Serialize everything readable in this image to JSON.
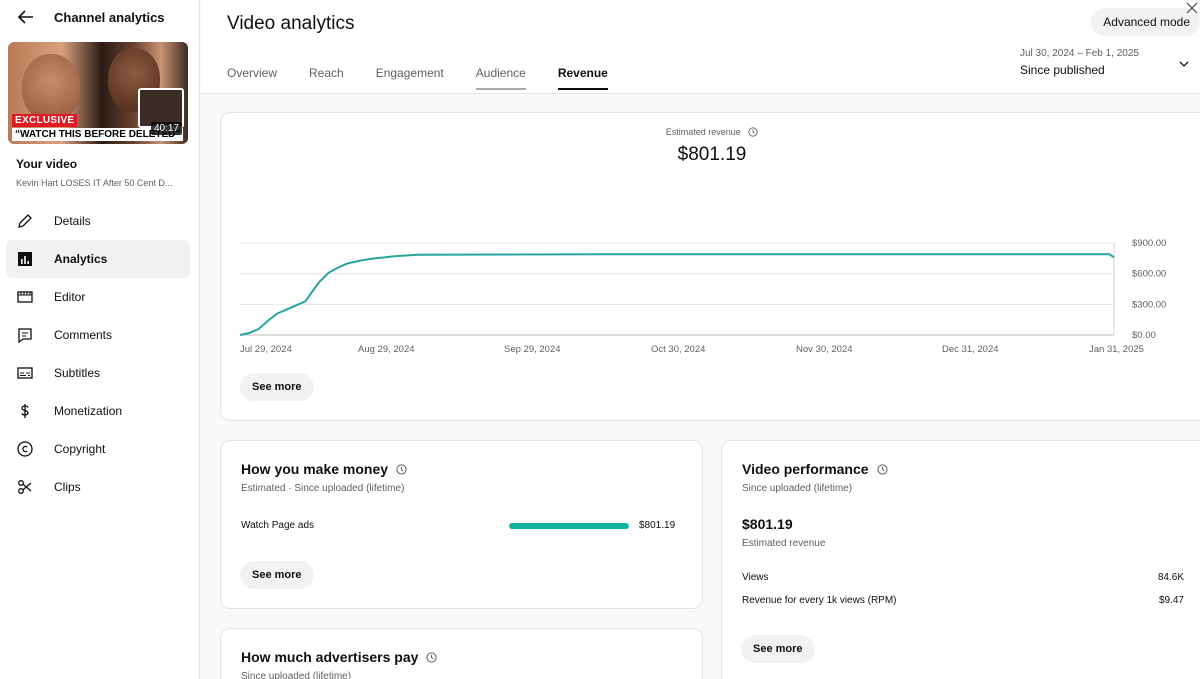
{
  "sidebar": {
    "title": "Channel analytics",
    "thumbnail": {
      "badge_exclusive": "EXCLUSIVE",
      "badge_caption": "“WATCH THIS BEFORE DELETED”",
      "duration": "40:17"
    },
    "your_video_label": "Your video",
    "video_title": "Kevin Hart LOSES IT After 50 Cent D...",
    "items": [
      {
        "label": "Details",
        "icon": "pencil-icon"
      },
      {
        "label": "Analytics",
        "icon": "analytics-icon"
      },
      {
        "label": "Editor",
        "icon": "editor-icon"
      },
      {
        "label": "Comments",
        "icon": "comments-icon"
      },
      {
        "label": "Subtitles",
        "icon": "subtitles-icon"
      },
      {
        "label": "Monetization",
        "icon": "dollar-icon"
      },
      {
        "label": "Copyright",
        "icon": "copyright-icon"
      },
      {
        "label": "Clips",
        "icon": "scissors-icon"
      }
    ],
    "active_item": "Analytics"
  },
  "header": {
    "title": "Video analytics",
    "advanced_mode_label": "Advanced mode",
    "tabs": [
      "Overview",
      "Reach",
      "Engagement",
      "Audience",
      "Revenue"
    ],
    "active_tab": "Revenue",
    "date_range": "Jul 30, 2024 – Feb 1, 2025",
    "date_label": "Since published"
  },
  "revenue_card": {
    "label": "Estimated revenue",
    "value": "$801.19",
    "see_more": "See more"
  },
  "chart_data": {
    "type": "line",
    "x_tick_labels": [
      "Jul 29, 2024",
      "Aug 29, 2024",
      "Sep 29, 2024",
      "Oct 30, 2024",
      "Nov 30, 2024",
      "Dec 31, 2024",
      "Jan 31, 2025"
    ],
    "y_tick_labels": [
      "$0.00",
      "$300.00",
      "$600.00",
      "$900.00"
    ],
    "ylim": [
      0,
      900
    ],
    "color": "#26a69a",
    "series": [
      {
        "x": [
          "2024-07-29",
          "2024-07-31",
          "2024-08-02",
          "2024-08-04",
          "2024-08-06",
          "2024-08-08",
          "2024-08-10",
          "2024-08-12",
          "2024-08-14",
          "2024-08-15",
          "2024-08-17",
          "2024-08-19",
          "2024-08-21",
          "2024-08-24",
          "2024-08-27",
          "2024-08-31",
          "2024-09-05",
          "2024-10-15",
          "2024-11-30",
          "2025-01-31",
          "2025-02-01"
        ],
        "values": [
          0,
          20,
          60,
          140,
          210,
          250,
          290,
          330,
          460,
          520,
          610,
          660,
          700,
          730,
          750,
          770,
          785,
          790,
          790,
          790,
          760
        ]
      }
    ]
  },
  "money_card": {
    "title": "How you make money",
    "subtitle": "Estimated · Since uploaded (lifetime)",
    "row_label": "Watch Page ads",
    "row_value": "$801.19",
    "row_fraction": 1.0,
    "see_more": "See more"
  },
  "performance_card": {
    "title": "Video performance",
    "subtitle": "Since uploaded (lifetime)",
    "value": "$801.19",
    "value_label": "Estimated revenue",
    "metrics": [
      {
        "label": "Views",
        "value": "84.6K"
      },
      {
        "label": "Revenue for every 1k views (RPM)",
        "value": "$9.47"
      }
    ],
    "see_more": "See more"
  },
  "advertisers_card": {
    "title": "How much advertisers pay",
    "subtitle": "Since uploaded (lifetime)"
  },
  "colors": {
    "accent_teal": "#12b3a0",
    "line_teal": "#26a69a"
  }
}
